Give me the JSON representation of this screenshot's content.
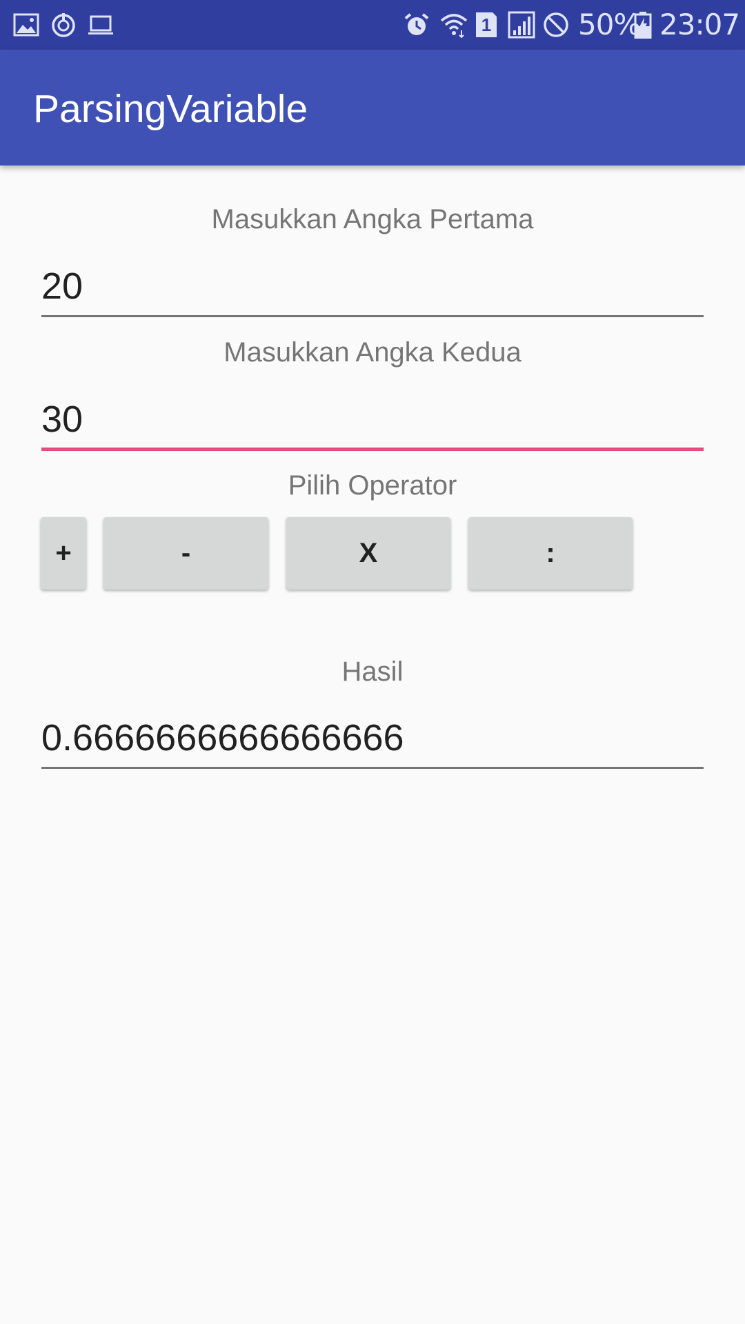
{
  "status_bar": {
    "left_icons": [
      "image-icon",
      "sync-icon",
      "laptop-icon"
    ],
    "right_icons": [
      "alarm-icon",
      "wifi-icon",
      "sim-1-icon",
      "signal-icon",
      "do-not-disturb-icon",
      "battery-charging-icon"
    ],
    "sim_slot": "1",
    "battery": "50%",
    "time": "23:07"
  },
  "app_bar": {
    "title": "ParsingVariable"
  },
  "form": {
    "first_label": "Masukkan Angka Pertama",
    "first_value": "20",
    "second_label": "Masukkan Angka Kedua",
    "second_value": "30",
    "operator_label": "Pilih Operator",
    "operators": [
      "+",
      "-",
      "X",
      ":"
    ],
    "result_label": "Hasil",
    "result_value": "0.6666666666666666"
  },
  "colors": {
    "status_bar": "#303f9f",
    "app_bar": "#3f51b5",
    "focused_underline": "#e94a7f",
    "button_bg": "#d6d7d7",
    "background": "#fafafa"
  }
}
